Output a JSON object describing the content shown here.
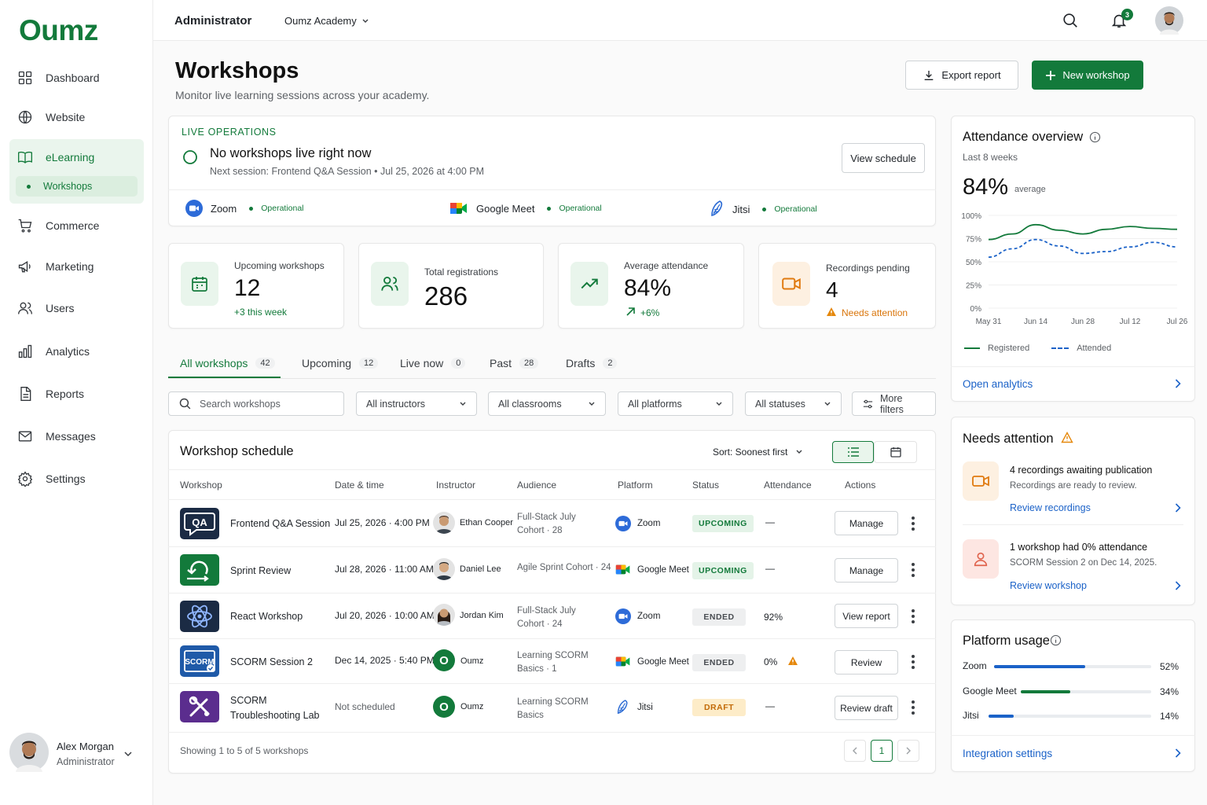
{
  "brand": {
    "name": "Oumz"
  },
  "sidebar": {
    "items": [
      {
        "label": "Dashboard",
        "icon": "grid-icon"
      },
      {
        "label": "Website",
        "icon": "globe-icon"
      },
      {
        "label": "eLearning",
        "icon": "book-icon"
      },
      {
        "label": "Commerce",
        "icon": "cart-icon"
      },
      {
        "label": "Marketing",
        "icon": "megaphone-icon"
      },
      {
        "label": "Users",
        "icon": "users-icon"
      },
      {
        "label": "Analytics",
        "icon": "bar-chart-icon"
      },
      {
        "label": "Reports",
        "icon": "file-icon"
      },
      {
        "label": "Messages",
        "icon": "mail-icon"
      },
      {
        "label": "Settings",
        "icon": "gear-icon"
      }
    ],
    "sub_item": "Workshops",
    "user": {
      "name": "Alex Morgan",
      "role": "Administrator"
    }
  },
  "topbar": {
    "role": "Administrator",
    "academy": "Oumz Academy",
    "notifications": "3"
  },
  "page": {
    "title": "Workshops",
    "subtitle": "Monitor live learning sessions across your academy.",
    "export_label": "Export report",
    "new_label": "New workshop"
  },
  "live": {
    "heading": "LIVE OPERATIONS",
    "title": "No workshops live right now",
    "next": "Next session: Frontend Q&A Session • Jul 25, 2026 at 4:00 PM",
    "view_schedule": "View schedule",
    "platforms": [
      {
        "name": "Zoom",
        "status": "Operational"
      },
      {
        "name": "Google Meet",
        "status": "Operational"
      },
      {
        "name": "Jitsi",
        "status": "Operational"
      }
    ]
  },
  "stats": [
    {
      "label": "Upcoming workshops",
      "value": "12",
      "note": "+3 this week"
    },
    {
      "label": "Total registrations",
      "value": "286"
    },
    {
      "label": "Average attendance",
      "value": "84%",
      "note": "+6%"
    },
    {
      "label": "Recordings pending",
      "value": "4",
      "note": "Needs attention"
    }
  ],
  "tabs": [
    {
      "label": "All workshops",
      "count": "42"
    },
    {
      "label": "Upcoming",
      "count": "12"
    },
    {
      "label": "Live now",
      "count": "0"
    },
    {
      "label": "Past",
      "count": "28"
    },
    {
      "label": "Drafts",
      "count": "2"
    }
  ],
  "filters": {
    "search_placeholder": "Search workshops",
    "instructors": "All instructors",
    "classrooms": "All classrooms",
    "platforms": "All platforms",
    "statuses": "All statuses",
    "more": "More filters"
  },
  "table": {
    "title": "Workshop schedule",
    "sort": "Sort: Soonest first",
    "columns": [
      "Workshop",
      "Date & time",
      "Instructor",
      "Audience",
      "Platform",
      "Status",
      "Attendance",
      "Actions"
    ],
    "rows": [
      {
        "name": "Frontend Q&A Session",
        "date": "Jul 25, 2026 · 4:00 PM",
        "instructor": "Ethan Cooper",
        "audience1": "Full-Stack July",
        "audience2": "Cohort · 28",
        "platform": "Zoom",
        "status": "UPCOMING",
        "attendance": "—",
        "action": "Manage"
      },
      {
        "name": "Sprint Review",
        "date": "Jul 28, 2026 · 11:00 AM",
        "instructor": "Daniel Lee",
        "audience1": "Agile Sprint Cohort · 24",
        "audience2": "",
        "platform": "Google Meet",
        "status": "UPCOMING",
        "attendance": "—",
        "action": "Manage"
      },
      {
        "name": "React Workshop",
        "date": "Jul 20, 2026 · 10:00 AM",
        "instructor": "Jordan Kim",
        "audience1": "Full-Stack July",
        "audience2": "Cohort · 24",
        "platform": "Zoom",
        "status": "ENDED",
        "attendance": "92%",
        "action": "View report"
      },
      {
        "name": "SCORM Session 2",
        "date": "Dec 14, 2025 · 5:40 PM",
        "instructor": "Oumz",
        "audience1": "Learning SCORM",
        "audience2": "Basics · 1",
        "platform": "Google Meet",
        "status": "ENDED",
        "attendance": "0%",
        "action": "Review"
      },
      {
        "name1": "SCORM",
        "name2": "Troubleshooting Lab",
        "date": "Not scheduled",
        "instructor": "Oumz",
        "audience1": "Learning SCORM",
        "audience2": "Basics",
        "platform": "Jitsi",
        "status": "DRAFT",
        "attendance": "—",
        "action": "Review draft"
      }
    ],
    "footer": "Showing 1 to 5 of 5 workshops",
    "page": "1",
    "icon_labels": {
      "qa": "QA",
      "scorm": "SCORM"
    },
    "instructor_initial": "O"
  },
  "attendance": {
    "title": "Attendance overview",
    "period": "Last 8 weeks",
    "value": "84%",
    "value_note": "average",
    "link": "Open analytics",
    "chart_data": {
      "type": "line",
      "x": [
        "May 31",
        "Jun 7",
        "Jun 14",
        "Jun 21",
        "Jun 28",
        "Jul 5",
        "Jul 12",
        "Jul 19",
        "Jul 26"
      ],
      "x_ticks": [
        "May 31",
        "Jun 14",
        "Jun 28",
        "Jul 12",
        "Jul 26"
      ],
      "y_ticks": [
        "100%",
        "75%",
        "50%",
        "25%",
        "0%"
      ],
      "ylim": [
        0,
        100
      ],
      "series": [
        {
          "name": "Registered",
          "color": "#137a3b",
          "dash": false,
          "values": [
            74,
            80,
            90,
            84,
            80,
            85,
            88,
            86,
            85
          ]
        },
        {
          "name": "Attended",
          "color": "#1b62c8",
          "dash": true,
          "values": [
            55,
            64,
            74,
            67,
            59,
            61,
            66,
            71,
            66
          ]
        }
      ]
    }
  },
  "needs": {
    "title": "Needs attention",
    "items": [
      {
        "title": "4 recordings awaiting publication",
        "desc": "Recordings are ready to review.",
        "link": "Review recordings"
      },
      {
        "title": "1 workshop had 0% attendance",
        "desc": "SCORM Session 2 on Dec 14, 2025.",
        "link": "Review workshop"
      }
    ]
  },
  "usage": {
    "title": "Platform usage",
    "items": [
      {
        "name": "Zoom",
        "pct": "52%",
        "value": 52,
        "color": "#1b62c8"
      },
      {
        "name": "Google Meet",
        "pct": "34%",
        "value": 34,
        "color": "#137a3b"
      },
      {
        "name": "Jitsi",
        "pct": "14%",
        "value": 14,
        "color": "#1b62c8"
      }
    ],
    "link": "Integration settings"
  }
}
